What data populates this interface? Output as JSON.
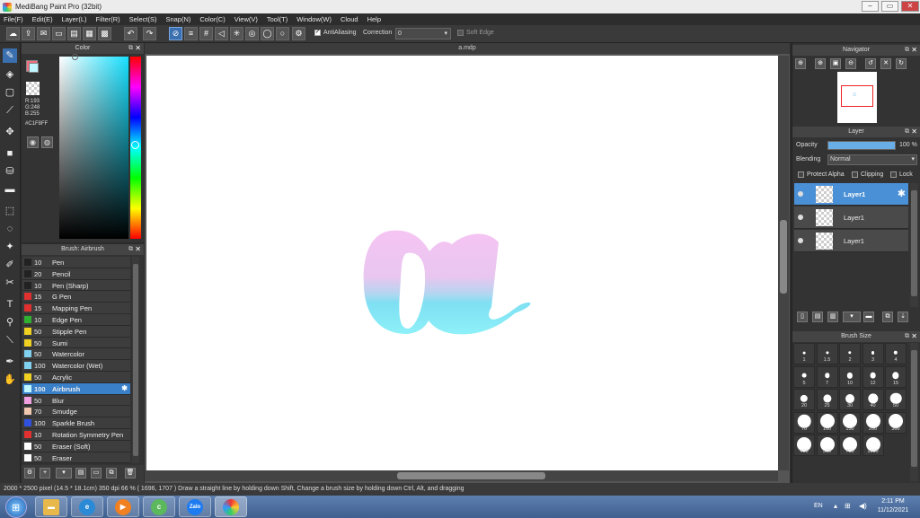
{
  "window": {
    "title": "MediBang Paint Pro (32bit)",
    "min": "–",
    "max": "▭",
    "close": "✕"
  },
  "menu": [
    "File(F)",
    "Edit(E)",
    "Layer(L)",
    "Filter(R)",
    "Select(S)",
    "Snap(N)",
    "Color(C)",
    "View(V)",
    "Tool(T)",
    "Window(W)",
    "Cloud",
    "Help"
  ],
  "toolbar": {
    "antialiasing_label": "AntiAliasing",
    "antialiasing_checked": true,
    "correction_label": "Correction",
    "correction_value": "0",
    "softedge_label": "Soft Edge",
    "softedge_checked": false
  },
  "color_panel": {
    "title": "Color",
    "r": "R:193",
    "g": "G:248",
    "b": "B:255",
    "hex": "#C1F8FF",
    "fg_color": "#c1f8ff",
    "accent_fg": "#f07080"
  },
  "brush_panel": {
    "title": "Brush: Airbrush",
    "items": [
      {
        "size": "10",
        "name": "Pen",
        "color": "#222222"
      },
      {
        "size": "20",
        "name": "Pencil",
        "color": "#222222"
      },
      {
        "size": "10",
        "name": "Pen (Sharp)",
        "color": "#222222"
      },
      {
        "size": "15",
        "name": "G Pen",
        "color": "#e03030"
      },
      {
        "size": "15",
        "name": "Mapping Pen",
        "color": "#e03030"
      },
      {
        "size": "10",
        "name": "Edge Pen",
        "color": "#30b030"
      },
      {
        "size": "50",
        "name": "Stipple Pen",
        "color": "#f0d020"
      },
      {
        "size": "50",
        "name": "Sumi",
        "color": "#f0d020"
      },
      {
        "size": "50",
        "name": "Watercolor",
        "color": "#80d0f0"
      },
      {
        "size": "100",
        "name": "Watercolor (Wet)",
        "color": "#80d0f0"
      },
      {
        "size": "50",
        "name": "Acrylic",
        "color": "#f0d020"
      },
      {
        "size": "100",
        "name": "Airbrush",
        "color": "#c1f8ff",
        "selected": true
      },
      {
        "size": "50",
        "name": "Blur",
        "color": "#f0a0e0"
      },
      {
        "size": "70",
        "name": "Smudge",
        "color": "#f0c8b0"
      },
      {
        "size": "100",
        "name": "Sparkle Brush",
        "color": "#3050e0"
      },
      {
        "size": "10",
        "name": "Rotation Symmetry Pen",
        "color": "#e03030"
      },
      {
        "size": "50",
        "name": "Eraser (Soft)",
        "color": "#ffffff"
      },
      {
        "size": "50",
        "name": "Eraser",
        "color": "#ffffff"
      }
    ]
  },
  "canvas": {
    "tab": "a.mdp",
    "glyph": "a"
  },
  "navigator": {
    "title": "Navigator"
  },
  "layer_panel": {
    "title": "Layer",
    "opacity_label": "Opacity",
    "opacity_value": "100 %",
    "opacity_fraction": 1.0,
    "blending_label": "Blending",
    "blending_value": "Normal",
    "protect_alpha": "Protect Alpha",
    "clipping": "Clipping",
    "lock": "Lock",
    "layers": [
      {
        "name": "Layer1",
        "selected": true
      },
      {
        "name": "Layer1",
        "selected": false
      },
      {
        "name": "Layer1",
        "selected": false
      }
    ]
  },
  "brush_size": {
    "title": "Brush Size",
    "sizes": [
      "1",
      "1.5",
      "2",
      "3",
      "4",
      "5",
      "7",
      "10",
      "12",
      "15",
      "20",
      "25",
      "30",
      "40",
      "50",
      "70",
      "100",
      "150",
      "200",
      "300",
      "400",
      "500",
      "700",
      "1000"
    ]
  },
  "status": {
    "text": "2000 * 2500 pixel   (14.5 * 18.1cm)   350 dpi   66 %   ( 1696, 1707 )   Draw a straight line by holding down Shift, Change a brush size by holding down Ctrl, Alt, and dragging"
  },
  "taskbar": {
    "lang": "EN",
    "time": "2:11 PM",
    "date": "11/12/2021",
    "apps": [
      "Windows Explorer",
      "Internet Explorer",
      "Media Player",
      "Coc Coc",
      "Zalo",
      "MediBang Paint"
    ]
  }
}
